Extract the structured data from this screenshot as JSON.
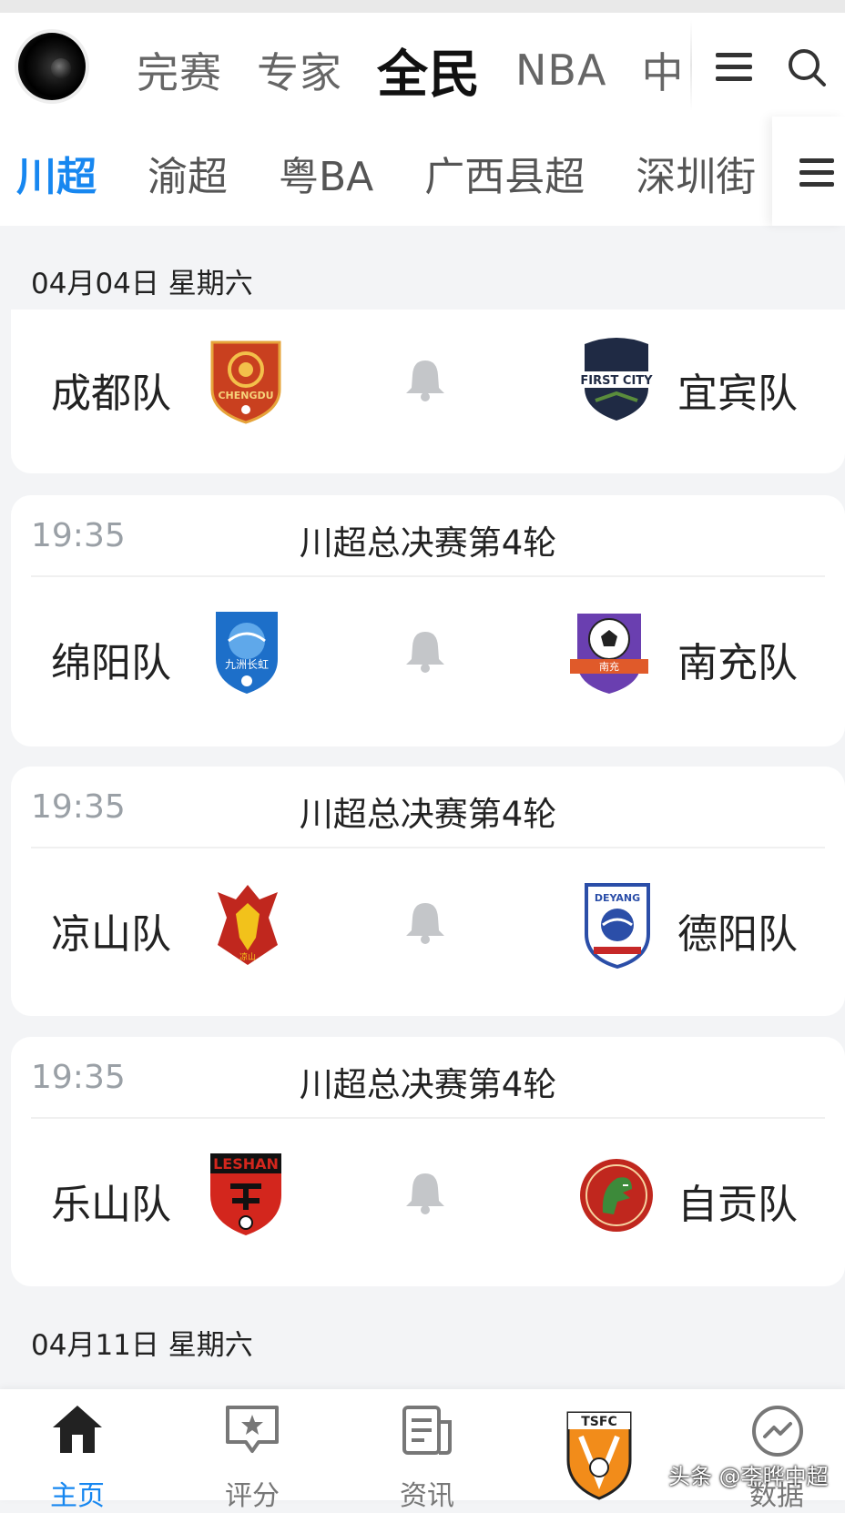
{
  "top_tabs": [
    "完赛",
    "专家",
    "全民",
    "NBA",
    "中"
  ],
  "top_active": "全民",
  "league_tabs": [
    "川超",
    "渝超",
    "粤BA",
    "广西县超",
    "深圳街"
  ],
  "league_active": "川超",
  "dates": [
    "04月04日 星期六",
    "04月11日 星期六"
  ],
  "matches": [
    {
      "time": "",
      "round": "",
      "home": "成都队",
      "away": "宜宾队",
      "home_logo": "chengdu-crest-icon",
      "away_logo": "first-city-crest-icon",
      "home_logo_text": "CHENGDU",
      "away_logo_text": "FIRST CITY"
    },
    {
      "time": "19:35",
      "round": "川超总决赛第4轮",
      "home": "绵阳队",
      "away": "南充队",
      "home_logo": "jiuzhou-changhong-crest-icon",
      "away_logo": "nanchong-crest-icon",
      "home_logo_text": "九洲长虹",
      "away_logo_text": "南充"
    },
    {
      "time": "19:35",
      "round": "川超总决赛第4轮",
      "home": "凉山队",
      "away": "德阳队",
      "home_logo": "liangshan-crest-icon",
      "away_logo": "deyang-crest-icon",
      "home_logo_text": "凉山",
      "away_logo_text": "DEYANG"
    },
    {
      "time": "19:35",
      "round": "川超总决赛第4轮",
      "home": "乐山队",
      "away": "自贡队",
      "home_logo": "leshan-crest-icon",
      "away_logo": "zigong-crest-icon",
      "home_logo_text": "LESHAN",
      "away_logo_text": ""
    }
  ],
  "bottom_nav": [
    "主页",
    "评分",
    "资讯",
    "",
    "数据"
  ],
  "bottom_nav_icons": [
    "home-icon",
    "rating-star-icon",
    "news-icon",
    "tsfc-crest-icon",
    "data-trend-icon"
  ],
  "tsfc_label": "TSFC",
  "watermark": "头条 @李晔中超",
  "colors": {
    "accent": "#1787f0",
    "muted": "#9aa0a6",
    "background": "#f3f4f6"
  }
}
